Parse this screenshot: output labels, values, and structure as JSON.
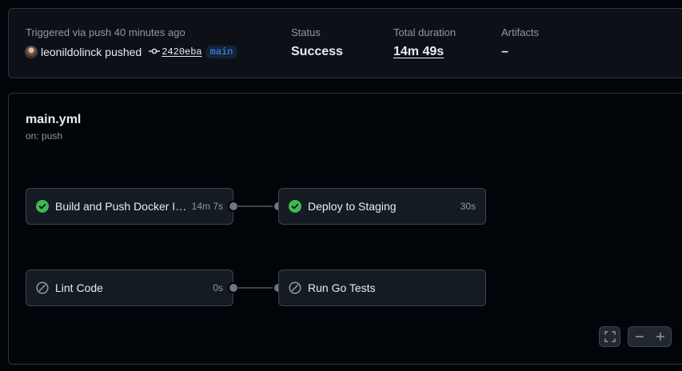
{
  "summary": {
    "trigger_label": "Triggered via push 40 minutes ago",
    "actor": "leonildolinck",
    "action": "pushed",
    "commit_sha": "2420eba",
    "branch": "main",
    "status_label": "Status",
    "status_value": "Success",
    "duration_label": "Total duration",
    "duration_value": "14m 49s",
    "artifacts_label": "Artifacts",
    "artifacts_value": "–"
  },
  "workflow": {
    "file": "main.yml",
    "trigger": "on: push"
  },
  "jobs": [
    {
      "name": "Build and Push Docker Image",
      "duration": "14m 7s",
      "status": "success"
    },
    {
      "name": "Deploy to Staging",
      "duration": "30s",
      "status": "success"
    },
    {
      "name": "Lint Code",
      "duration": "0s",
      "status": "skipped"
    },
    {
      "name": "Run Go Tests",
      "duration": "",
      "status": "skipped"
    }
  ],
  "colors": {
    "success": "#3fb950",
    "skipped": "#9198a1",
    "accent": "#4493f8"
  },
  "icons": {
    "success": "check-circle-icon",
    "skipped": "skip-icon",
    "fullscreen": "fullscreen-icon",
    "zoom_out": "minus-icon",
    "zoom_in": "plus-icon",
    "commit": "git-commit-icon"
  }
}
